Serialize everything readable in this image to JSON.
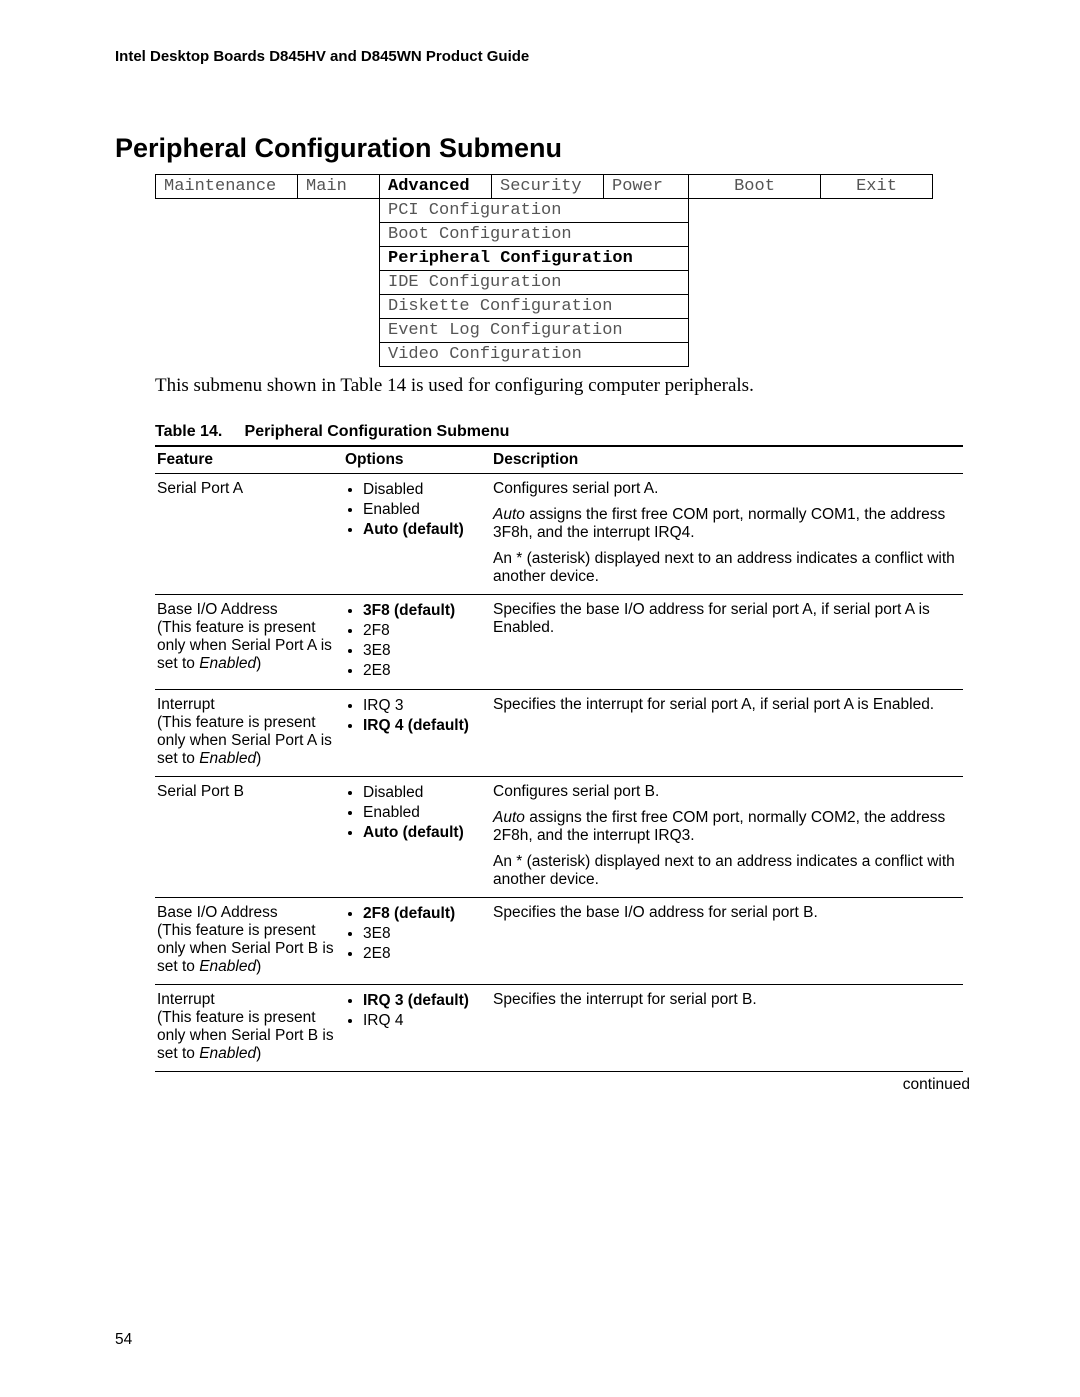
{
  "header": "Intel Desktop Boards D845HV and D845WN Product Guide",
  "section_title": "Peripheral Configuration Submenu",
  "nav": {
    "tabs": [
      "Maintenance",
      "Main",
      "Advanced",
      "Security",
      "Power",
      "Boot",
      "Exit"
    ],
    "active_index": 2,
    "submenu": [
      "PCI Configuration",
      "Boot Configuration",
      "Peripheral Configuration",
      "IDE Configuration",
      "Diskette Configuration",
      "Event Log Configuration",
      "Video Configuration"
    ],
    "submenu_active_index": 2
  },
  "intro": "This submenu shown in Table 14 is used for configuring computer peripherals.",
  "table_caption_prefix": "Table 14.",
  "table_caption_title": "Peripheral Configuration Submenu",
  "columns": {
    "feature": "Feature",
    "options": "Options",
    "description": "Description"
  },
  "rows": [
    {
      "feature": "Serial Port A",
      "feature_note": "",
      "options": [
        {
          "text": "Disabled",
          "bold": false
        },
        {
          "text": "Enabled",
          "bold": false
        },
        {
          "text": "Auto (default)",
          "bold": true
        }
      ],
      "desc": [
        {
          "plain": "Configures serial port A."
        },
        {
          "italic_lead": "Auto",
          "rest": " assigns the first free COM port, normally COM1, the address 3F8h, and the interrupt IRQ4."
        },
        {
          "plain": "An * (asterisk) displayed next to an address indicates a conflict with another device."
        }
      ]
    },
    {
      "feature": "Base I/O Address",
      "feature_note_pre": "(This feature is present only when Serial Port A is set to ",
      "feature_note_it": "Enabled",
      "feature_note_post": ")",
      "options": [
        {
          "text": "3F8 (default)",
          "bold": true
        },
        {
          "text": "2F8",
          "bold": false
        },
        {
          "text": "3E8",
          "bold": false
        },
        {
          "text": "2E8",
          "bold": false
        }
      ],
      "desc": [
        {
          "plain": "Specifies the base I/O address for serial port A, if serial port A is Enabled."
        }
      ]
    },
    {
      "feature": "Interrupt",
      "feature_note_pre": "(This feature is present only when Serial Port A is set to ",
      "feature_note_it": "Enabled",
      "feature_note_post": ")",
      "options": [
        {
          "text": "IRQ 3",
          "bold": false
        },
        {
          "text": "IRQ 4 (default)",
          "bold": true
        }
      ],
      "desc": [
        {
          "plain": "Specifies the interrupt for serial port A, if serial port A is Enabled."
        }
      ]
    },
    {
      "feature": "Serial Port B",
      "feature_note": "",
      "options": [
        {
          "text": "Disabled",
          "bold": false
        },
        {
          "text": "Enabled",
          "bold": false
        },
        {
          "text": "Auto (default)",
          "bold": true
        }
      ],
      "desc": [
        {
          "plain": "Configures serial port B."
        },
        {
          "italic_lead": "Auto",
          "rest": " assigns the first free COM port, normally COM2, the address 2F8h, and the interrupt IRQ3."
        },
        {
          "plain": "An * (asterisk) displayed next to an address indicates a conflict with another device."
        }
      ]
    },
    {
      "feature": "Base I/O Address",
      "feature_note_pre": "(This feature is present only when Serial Port B is set to ",
      "feature_note_it": "Enabled",
      "feature_note_post": ")",
      "options": [
        {
          "text": "2F8 (default)",
          "bold": true
        },
        {
          "text": "3E8",
          "bold": false
        },
        {
          "text": "2E8",
          "bold": false
        }
      ],
      "desc": [
        {
          "plain": "Specifies the base I/O address for serial port B."
        }
      ]
    },
    {
      "feature": "Interrupt",
      "feature_note_pre": "(This feature is present only when Serial Port B is set to ",
      "feature_note_it": "Enabled",
      "feature_note_post": ")",
      "options": [
        {
          "text": "IRQ 3 (default)",
          "bold": true
        },
        {
          "text": "IRQ 4",
          "bold": false
        }
      ],
      "desc": [
        {
          "plain": "Specifies the interrupt for serial port B."
        }
      ]
    }
  ],
  "continued": "continued",
  "page_number": "54"
}
